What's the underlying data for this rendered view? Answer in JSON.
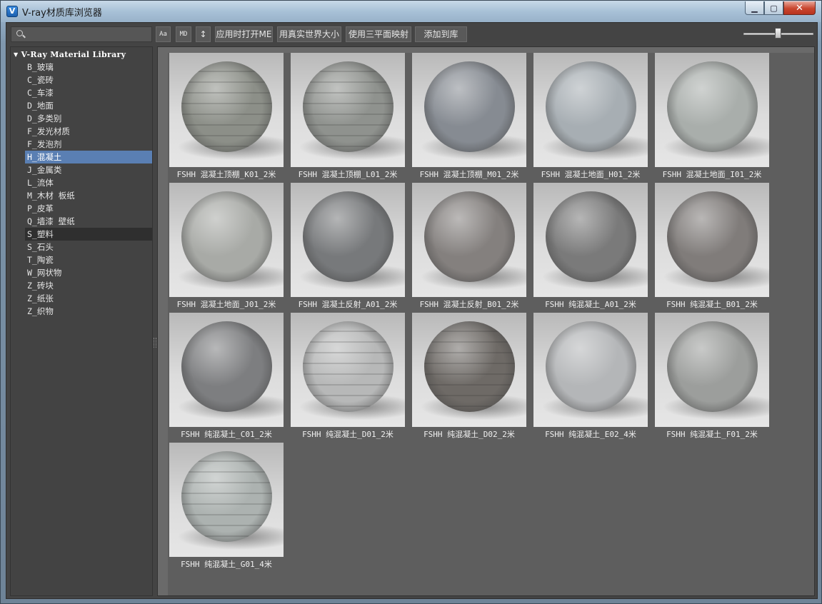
{
  "window": {
    "title": "V-ray材质库浏览器",
    "icon": "vray-logo-icon"
  },
  "toolbar": {
    "search_placeholder": "",
    "btn_font": "Aa",
    "btn_md": "MD",
    "btn_sort": "↕",
    "btn_open_me": "应用时打开ME",
    "btn_real_size": "用真实世界大小",
    "btn_triplanar": "使用三平面映射",
    "btn_add_lib": "添加到库",
    "thumb_size_level": 0.5
  },
  "tree": {
    "root": "V-Ray Material Library",
    "items": [
      "B_玻璃",
      "C_瓷砖",
      "C_车漆",
      "D_地面",
      "D_多类别",
      "F_发光材质",
      "F_发泡剂",
      "H_混凝土",
      "J_金属类",
      "L_流体",
      "M_木材 板纸",
      "P_皮革",
      "Q_墙漆 壁纸",
      "S_塑料",
      "S_石头",
      "T_陶瓷",
      "W_网状物",
      "Z_砖块",
      "Z_纸张",
      "Z_织物"
    ],
    "selected_index": 7,
    "hover_index": 13
  },
  "materials": [
    {
      "name": "FSHH 混凝土顶棚_K01_2米",
      "tone": "#8c8f88",
      "stripes": true
    },
    {
      "name": "FSHH 混凝土顶棚_L01_2米",
      "tone": "#8f928e",
      "stripes": true
    },
    {
      "name": "FSHH 混凝土顶棚_M01_2米",
      "tone": "#868b92",
      "stripes": false
    },
    {
      "name": "FSHH 混凝土地面_H01_2米",
      "tone": "#a7aeb3",
      "stripes": false
    },
    {
      "name": "FSHH 混凝土地面_I01_2米",
      "tone": "#a9aeab",
      "stripes": false
    },
    {
      "name": "FSHH 混凝土地面_J01_2米",
      "tone": "#a8aaa6",
      "stripes": false
    },
    {
      "name": "FSHH 混凝土反射_A01_2米",
      "tone": "#77797b",
      "stripes": false
    },
    {
      "name": "FSHH 混凝土反射_B01_2米",
      "tone": "#84807e",
      "stripes": false
    },
    {
      "name": "FSHH 纯混凝土_A01_2米",
      "tone": "#7a7a7a",
      "stripes": false
    },
    {
      "name": "FSHH 纯混凝土_B01_2米",
      "tone": "#807c7a",
      "stripes": false
    },
    {
      "name": "FSHH 纯混凝土_C01_2米",
      "tone": "#7d7e80",
      "stripes": false
    },
    {
      "name": "FSHH 纯混凝土_D01_2米",
      "tone": "#b7b8b8",
      "stripes": true
    },
    {
      "name": "FSHH 纯混凝土_D02_2米",
      "tone": "#6e6a66",
      "stripes": true
    },
    {
      "name": "FSHH 纯混凝土_E02_4米",
      "tone": "#b4b6b8",
      "stripes": false
    },
    {
      "name": "FSHH 纯混凝土_F01_2米",
      "tone": "#9c9e9c",
      "stripes": false
    },
    {
      "name": "FSHH 纯混凝土_G01_4米",
      "tone": "#acb2b0",
      "stripes": true
    }
  ]
}
